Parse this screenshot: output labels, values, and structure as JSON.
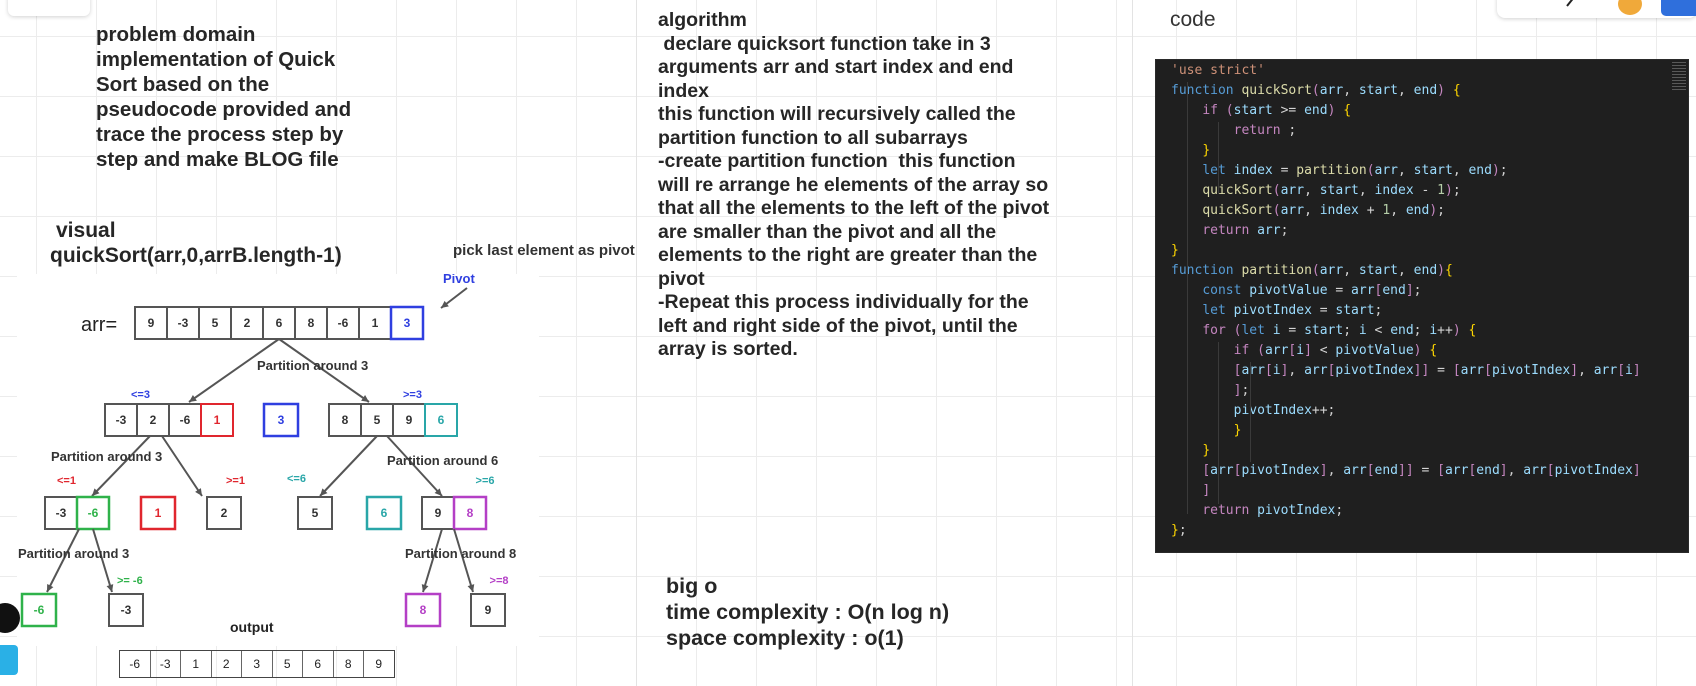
{
  "problem_domain": {
    "lines": [
      "problem domain",
      "implementation of Quick",
      "Sort based on the",
      "pseudocode provided and",
      "trace the process step by",
      "step and make BLOG file"
    ]
  },
  "visual": {
    "heading_line1": "visual",
    "heading_line2": "quickSort(arr,0,arrB.length-1)",
    "pick_label": "pick last element as pivot"
  },
  "diagram": {
    "arr_label": "arr=",
    "pivot_label": "Pivot",
    "initial_array": [
      "9",
      "-3",
      "5",
      "2",
      "6",
      "8",
      "-6",
      "1",
      "3"
    ],
    "level1": {
      "left": [
        "-3",
        "2",
        "-6",
        "1"
      ],
      "pivot": "3",
      "right": [
        "8",
        "5",
        "9",
        "6"
      ],
      "left_label": "<=3",
      "right_label": ">=3",
      "partition_label": "Partition around 3"
    },
    "level2": {
      "left_partition_label": "Partition around 3",
      "right_partition_label": "Partition around 6",
      "ll": [
        "-3",
        "-6"
      ],
      "ll_label": "<=1",
      "lp": "1",
      "lr": "2",
      "lr_label": ">=1",
      "rl": "5",
      "rl_label": "<=6",
      "rp": "6",
      "rr": [
        "9",
        "8"
      ],
      "rr_label": ">=6"
    },
    "level3": {
      "left_partition_label": "Partition around 3",
      "right_partition_label": "Partition around 8",
      "a": "-6",
      "b": "-3",
      "b_label": ">= -6",
      "c": "8",
      "d": "9",
      "d_label": ">=8"
    },
    "output_label": "output",
    "output_array": [
      "-6",
      "-3",
      "1",
      "2",
      "3",
      "5",
      "6",
      "8",
      "9"
    ]
  },
  "algorithm": {
    "lines": [
      "algorithm",
      " declare quicksort function take in 3",
      "arguments arr and start index and end",
      "index",
      "this function will recursively called the",
      "partition function to all subarrays",
      "-create partition function  this function",
      "will re arrange he elements of the array so",
      "that all the elements to the left of the pivot",
      "are smaller than the pivot and all the",
      "elements to the right are greater than the",
      "pivot",
      "-Repeat this process individually for the",
      "left and right side of the pivot, until the",
      "array is sorted."
    ]
  },
  "big_o": {
    "heading": "big o",
    "time": "time complexity : O(n log n)",
    "space": "space complexity : o(1)"
  },
  "code": {
    "heading": "code",
    "lines": [
      "'use strict'",
      "function quickSort(arr, start, end) {",
      "    if (start >= end) {",
      "        return ;",
      "    }",
      "    let index = partition(arr, start, end);",
      "    quickSort(arr, start, index - 1);",
      "    quickSort(arr, index + 1, end);",
      "    return arr;",
      "}",
      "function partition(arr, start, end){",
      "    const pivotValue = arr[end];",
      "    let pivotIndex = start;",
      "    for (let i = start; i < end; i++) {",
      "        if (arr[i] < pivotValue) {",
      "        [arr[i], arr[pivotIndex]] = [arr[pivotIndex], arr[i]",
      "        ];",
      "        pivotIndex++;",
      "        }",
      "    }",
      "    [arr[pivotIndex], arr[end]] = [arr[end], arr[pivotIndex]",
      "    ]",
      "    return pivotIndex;",
      "};"
    ]
  },
  "colors": {
    "pivot_blue": "#2f3fe0",
    "red": "#e0262e",
    "green": "#2fb24a",
    "teal": "#29a6a8",
    "purple": "#b43fc6",
    "code_bg": "#1f1f1f",
    "code_keyword": "#569cd6",
    "code_function": "#dcdcaa",
    "code_var": "#9cdcfe",
    "code_string": "#ce9178",
    "code_control": "#c586c0",
    "code_bracket": "#ffd700"
  }
}
